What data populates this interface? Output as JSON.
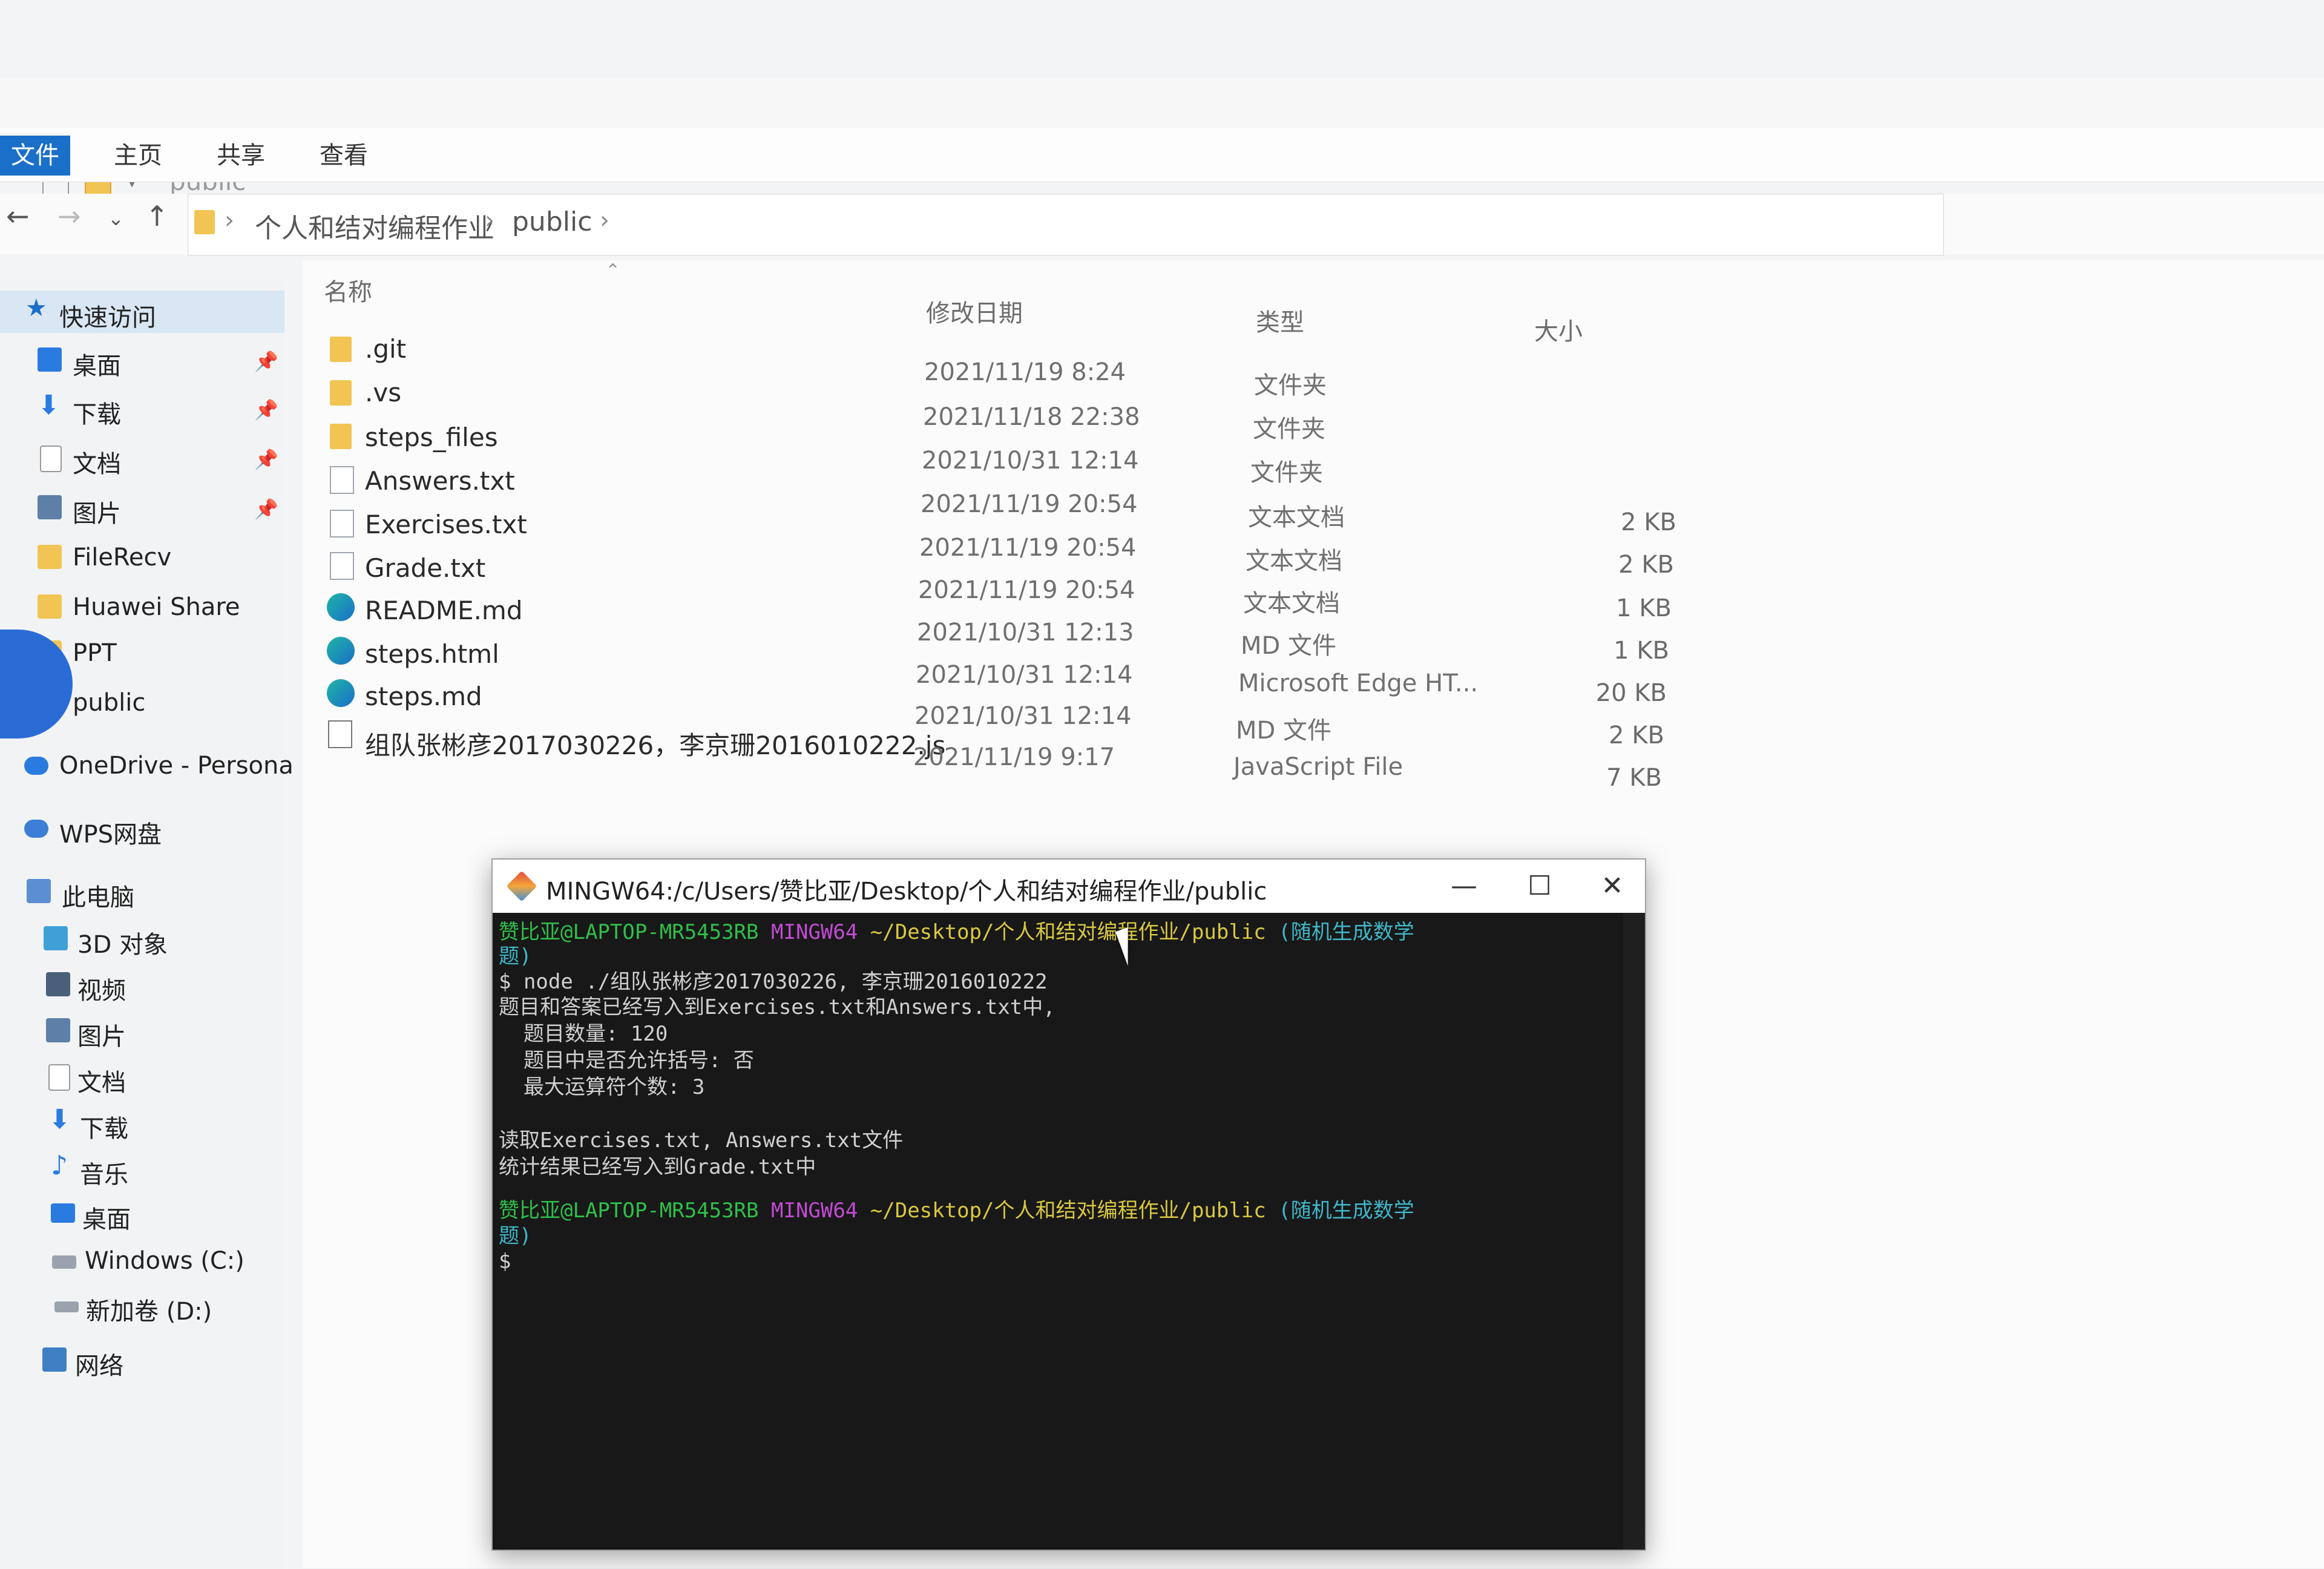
{
  "explorer": {
    "title": "public",
    "ribbon_tabs": [
      "文件",
      "主页",
      "共享",
      "查看"
    ],
    "breadcrumb": [
      "个人和结对编程作业",
      "public"
    ],
    "sidebar": [
      {
        "label": "快速访问",
        "icon": "star-icon",
        "pinned": false
      },
      {
        "label": "桌面",
        "icon": "desktop-icon",
        "pinned": true
      },
      {
        "label": "下载",
        "icon": "download-icon",
        "pinned": true
      },
      {
        "label": "文档",
        "icon": "document-icon",
        "pinned": true
      },
      {
        "label": "图片",
        "icon": "picture-icon",
        "pinned": true
      },
      {
        "label": "FileRecv",
        "icon": "folder-icon",
        "pinned": false
      },
      {
        "label": "Huawei Share",
        "icon": "folder-icon",
        "pinned": false
      },
      {
        "label": "PPT",
        "icon": "folder-icon",
        "pinned": false
      },
      {
        "label": "public",
        "icon": "folder-icon",
        "pinned": false
      },
      {
        "label": "OneDrive - Persona",
        "icon": "cloud-icon",
        "pinned": false
      },
      {
        "label": "WPS网盘",
        "icon": "cloud-icon",
        "pinned": false
      },
      {
        "label": "此电脑",
        "icon": "computer-icon",
        "pinned": false
      },
      {
        "label": "3D 对象",
        "icon": "cube-icon",
        "pinned": false
      },
      {
        "label": "视频",
        "icon": "video-icon",
        "pinned": false
      },
      {
        "label": "图片",
        "icon": "picture-icon",
        "pinned": false
      },
      {
        "label": "文档",
        "icon": "document-icon",
        "pinned": false
      },
      {
        "label": "下载",
        "icon": "download-icon",
        "pinned": false
      },
      {
        "label": "音乐",
        "icon": "music-icon",
        "pinned": false
      },
      {
        "label": "桌面",
        "icon": "desktop-icon",
        "pinned": false
      },
      {
        "label": "Windows (C:)",
        "icon": "drive-icon",
        "pinned": false
      },
      {
        "label": "新加卷 (D:)",
        "icon": "drive-icon",
        "pinned": false
      },
      {
        "label": "网络",
        "icon": "network-icon",
        "pinned": false
      }
    ],
    "columns": {
      "name": "名称",
      "date": "修改日期",
      "type": "类型",
      "size": "大小"
    },
    "files": [
      {
        "name": ".git",
        "date": "2021/11/19 8:24",
        "type": "文件夹",
        "size": "",
        "icon": "folder"
      },
      {
        "name": ".vs",
        "date": "2021/11/18 22:38",
        "type": "文件夹",
        "size": "",
        "icon": "folder"
      },
      {
        "name": "steps_files",
        "date": "2021/10/31 12:14",
        "type": "文件夹",
        "size": "",
        "icon": "folder"
      },
      {
        "name": "Answers.txt",
        "date": "2021/11/19 20:54",
        "type": "文本文档",
        "size": "2 KB",
        "icon": "txt"
      },
      {
        "name": "Exercises.txt",
        "date": "2021/11/19 20:54",
        "type": "文本文档",
        "size": "2 KB",
        "icon": "txt"
      },
      {
        "name": "Grade.txt",
        "date": "2021/11/19 20:54",
        "type": "文本文档",
        "size": "1 KB",
        "icon": "txt"
      },
      {
        "name": "README.md",
        "date": "2021/10/31 12:13",
        "type": "MD 文件",
        "size": "1 KB",
        "icon": "edge"
      },
      {
        "name": "steps.html",
        "date": "2021/10/31 12:14",
        "type": "Microsoft Edge HT...",
        "size": "20 KB",
        "icon": "edge"
      },
      {
        "name": "steps.md",
        "date": "2021/10/31 12:14",
        "type": "MD 文件",
        "size": "2 KB",
        "icon": "edge"
      },
      {
        "name": "组队张彬彦2017030226，李京珊2016010222.js",
        "date": "2021/11/19 9:17",
        "type": "JavaScript File",
        "size": "7 KB",
        "icon": "js"
      }
    ]
  },
  "terminal": {
    "title": "MINGW64:/c/Users/赞比亚/Desktop/个人和结对编程作业/public",
    "prompt_user": "赞比亚@LAPTOP-MR5453RB",
    "prompt_env": "MINGW64",
    "prompt_path": "~/Desktop/个人和结对编程作业/public",
    "prompt_branch": "(随机生成数学",
    "prompt_branch_cont": "题)",
    "command": "$ node ./组队张彬彦2017030226, 李京珊2016010222",
    "output": [
      "题目和答案已经写入到Exercises.txt和Answers.txt中,",
      "  题目数量: 120",
      "  题目中是否允许括号: 否",
      "  最大运算符个数: 3",
      "",
      "读取Exercises.txt, Answers.txt文件",
      "统计结果已经写入到Grade.txt中"
    ],
    "final_prompt": "$"
  },
  "colors": {
    "accent": "#1a6fc9",
    "terminal_bg": "#181818",
    "prompt_green": "#2fbf4a",
    "prompt_magenta": "#c24bd4",
    "prompt_yellow": "#d9c840",
    "prompt_cyan": "#3fb7c9"
  }
}
